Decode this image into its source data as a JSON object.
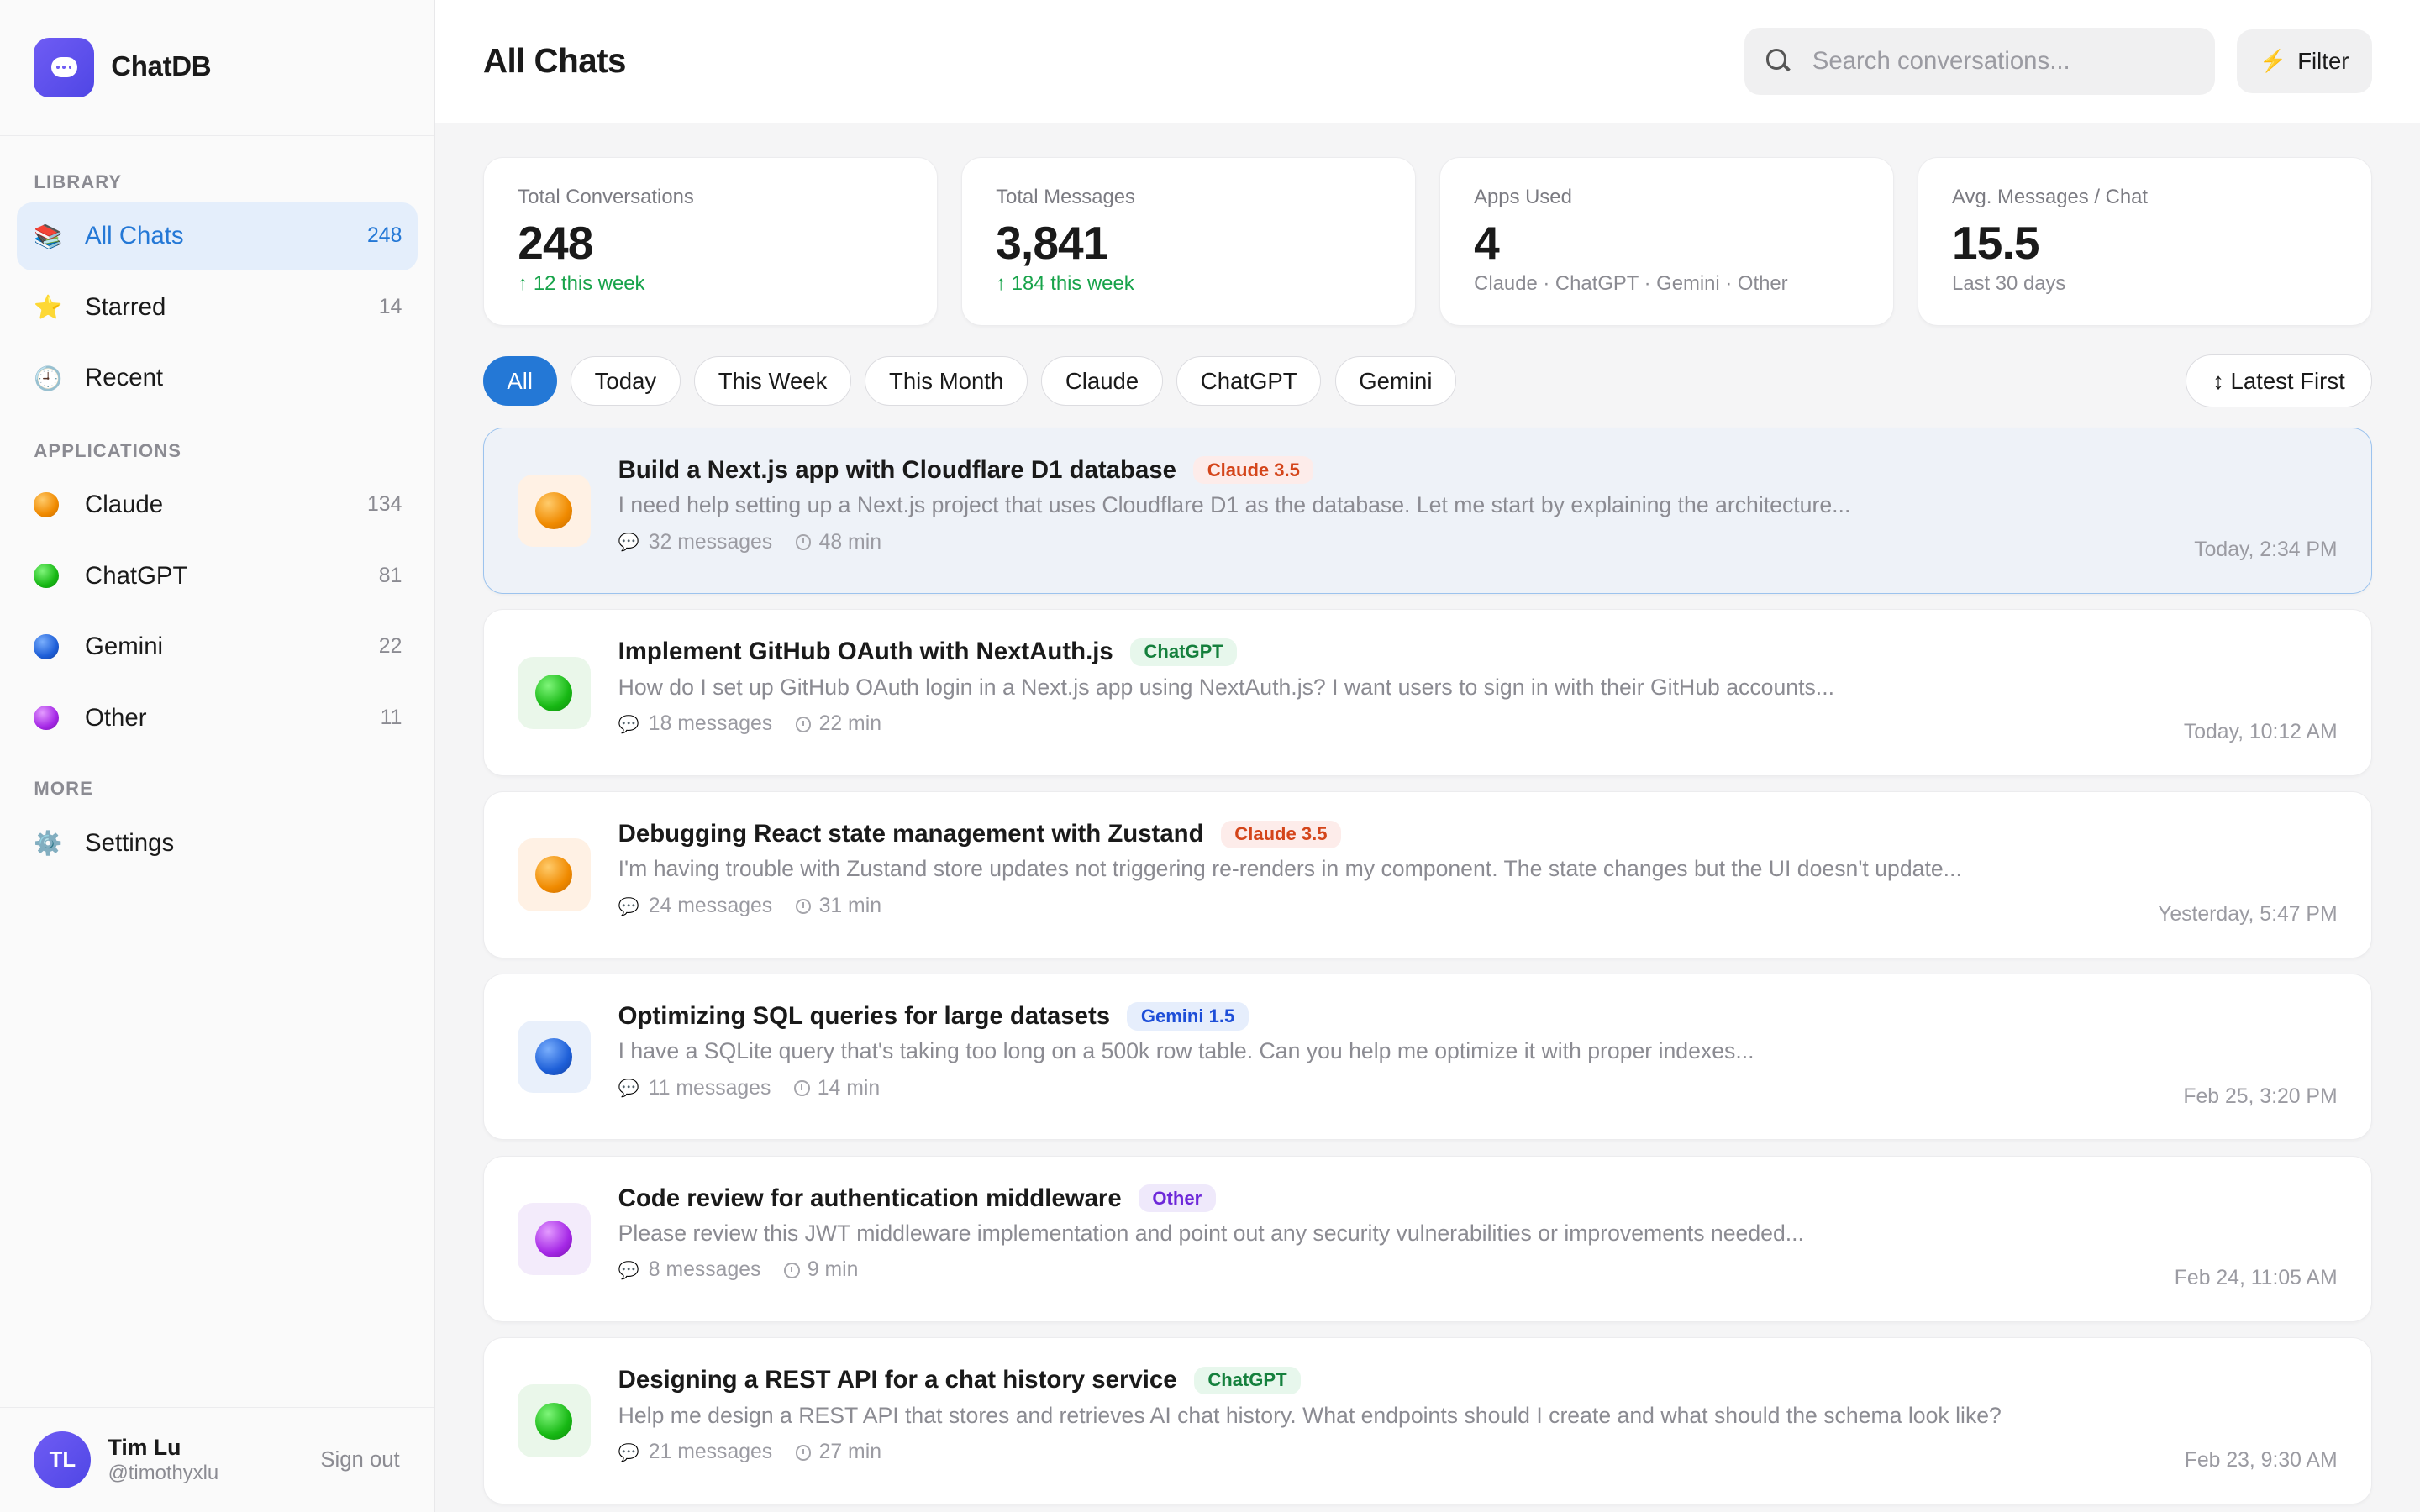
{
  "brand": {
    "name": "ChatDB"
  },
  "sidebar": {
    "sections": {
      "library": "LIBRARY",
      "applications": "APPLICATIONS",
      "more": "MORE"
    },
    "library_items": [
      {
        "label": "All Chats",
        "count": "248",
        "icon": "books-icon"
      },
      {
        "label": "Starred",
        "count": "14",
        "icon": "star-icon"
      },
      {
        "label": "Recent",
        "count": "",
        "icon": "clock-icon"
      }
    ],
    "app_items": [
      {
        "label": "Claude",
        "count": "134",
        "color": "#f08a00"
      },
      {
        "label": "ChatGPT",
        "count": "81",
        "color": "#17b814"
      },
      {
        "label": "Gemini",
        "count": "22",
        "color": "#1e5fd8"
      },
      {
        "label": "Other",
        "count": "11",
        "color": "#a528e6"
      }
    ],
    "more_items": [
      {
        "label": "Settings",
        "icon": "gear-icon"
      }
    ],
    "user": {
      "initials": "TL",
      "name": "Tim Lu",
      "handle": "@timothyxlu",
      "signout": "Sign out"
    }
  },
  "header": {
    "title": "All Chats",
    "search_placeholder": "Search conversations...",
    "filter_label": "Filter"
  },
  "stats": [
    {
      "label": "Total Conversations",
      "value": "248",
      "sub": "↑ 12 this week"
    },
    {
      "label": "Total Messages",
      "value": "3,841",
      "sub": "↑ 184 this week"
    },
    {
      "label": "Apps Used",
      "value": "4",
      "sub": "Claude · ChatGPT · Gemini · Other"
    },
    {
      "label": "Avg. Messages / Chat",
      "value": "15.5",
      "sub": "Last 30 days"
    }
  ],
  "filters": {
    "chips": [
      "All",
      "Today",
      "This Week",
      "This Month",
      "Claude",
      "ChatGPT",
      "Gemini"
    ],
    "active": "All",
    "sort_label": "↕ Latest First"
  },
  "chats": [
    {
      "title": "Build a Next.js app with Cloudflare D1 database",
      "badge": "Claude 3.5",
      "app": "claude",
      "preview": "I need help setting up a Next.js project that uses Cloudflare D1 as the database. Let me start by explaining the architecture...",
      "messages": "32 messages",
      "duration": "48 min",
      "time": "Today, 2:34 PM"
    },
    {
      "title": "Implement GitHub OAuth with NextAuth.js",
      "badge": "ChatGPT",
      "app": "chatgpt",
      "preview": "How do I set up GitHub OAuth login in a Next.js app using NextAuth.js? I want users to sign in with their GitHub accounts...",
      "messages": "18 messages",
      "duration": "22 min",
      "time": "Today, 10:12 AM"
    },
    {
      "title": "Debugging React state management with Zustand",
      "badge": "Claude 3.5",
      "app": "claude",
      "preview": "I'm having trouble with Zustand store updates not triggering re-renders in my component. The state changes but the UI doesn't update...",
      "messages": "24 messages",
      "duration": "31 min",
      "time": "Yesterday, 5:47 PM"
    },
    {
      "title": "Optimizing SQL queries for large datasets",
      "badge": "Gemini 1.5",
      "app": "gemini",
      "preview": "I have a SQLite query that's taking too long on a 500k row table. Can you help me optimize it with proper indexes...",
      "messages": "11 messages",
      "duration": "14 min",
      "time": "Feb 25, 3:20 PM"
    },
    {
      "title": "Code review for authentication middleware",
      "badge": "Other",
      "app": "other",
      "preview": "Please review this JWT middleware implementation and point out any security vulnerabilities or improvements needed...",
      "messages": "8 messages",
      "duration": "9 min",
      "time": "Feb 24, 11:05 AM"
    },
    {
      "title": "Designing a REST API for a chat history service",
      "badge": "ChatGPT",
      "app": "chatgpt",
      "preview": "Help me design a REST API that stores and retrieves AI chat history. What endpoints should I create and what should the schema look like?",
      "messages": "21 messages",
      "duration": "27 min",
      "time": "Feb 23, 9:30 AM"
    }
  ]
}
